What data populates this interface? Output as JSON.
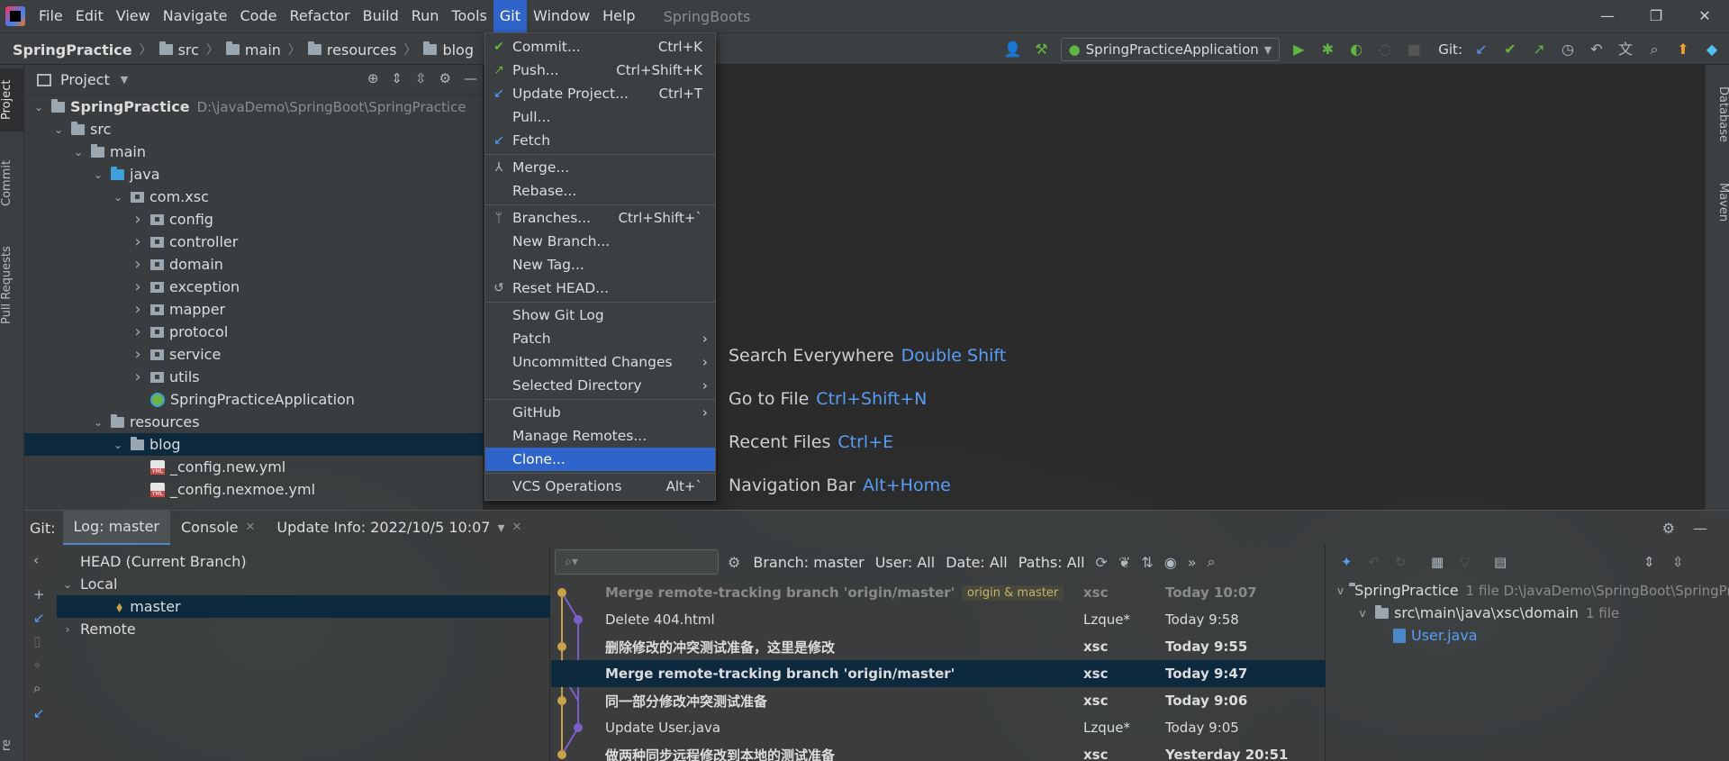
{
  "menubar": {
    "items": [
      "File",
      "Edit",
      "View",
      "Navigate",
      "Code",
      "Refactor",
      "Build",
      "Run",
      "Tools",
      "Git",
      "Window",
      "Help"
    ],
    "active": "Git",
    "window_title": "SpringBoots"
  },
  "window_controls": {
    "minimize": "—",
    "restore": "❐",
    "close": "✕"
  },
  "breadcrumb": [
    "SpringPractice",
    "src",
    "main",
    "resources",
    "blog"
  ],
  "toolbar": {
    "run_config": "SpringPracticeApplication",
    "git_label": "Git:"
  },
  "left_strip": {
    "tabs": [
      "Project",
      "Commit",
      "Pull Requests"
    ],
    "bottom": "re"
  },
  "right_strip": {
    "tabs": [
      "Database",
      "Maven"
    ]
  },
  "project": {
    "header": "Project",
    "tree": [
      {
        "label": "SpringPractice",
        "hint": "D:\\javaDemo\\SpringBoot\\SpringPractice",
        "depth": 0,
        "chev": "v",
        "icon": "module",
        "bold": true
      },
      {
        "label": "src",
        "depth": 1,
        "chev": "v",
        "icon": "folder"
      },
      {
        "label": "main",
        "depth": 2,
        "chev": "v",
        "icon": "folder"
      },
      {
        "label": "java",
        "depth": 3,
        "chev": "v",
        "icon": "folder-blue"
      },
      {
        "label": "com.xsc",
        "depth": 4,
        "chev": "v",
        "icon": "package"
      },
      {
        "label": "config",
        "depth": 5,
        "chev": ">",
        "icon": "package"
      },
      {
        "label": "controller",
        "depth": 5,
        "chev": ">",
        "icon": "package"
      },
      {
        "label": "domain",
        "depth": 5,
        "chev": ">",
        "icon": "package"
      },
      {
        "label": "exception",
        "depth": 5,
        "chev": ">",
        "icon": "package"
      },
      {
        "label": "mapper",
        "depth": 5,
        "chev": ">",
        "icon": "package"
      },
      {
        "label": "protocol",
        "depth": 5,
        "chev": ">",
        "icon": "package"
      },
      {
        "label": "service",
        "depth": 5,
        "chev": ">",
        "icon": "package"
      },
      {
        "label": "utils",
        "depth": 5,
        "chev": ">",
        "icon": "package"
      },
      {
        "label": "SpringPracticeApplication",
        "depth": 5,
        "chev": "",
        "icon": "spring"
      },
      {
        "label": "resources",
        "depth": 3,
        "chev": "v",
        "icon": "folder-res"
      },
      {
        "label": "blog",
        "depth": 4,
        "chev": "v",
        "icon": "folder",
        "selected": true
      },
      {
        "label": "_config.new.yml",
        "depth": 5,
        "chev": "",
        "icon": "yml"
      },
      {
        "label": "_config.nexmoe.yml",
        "depth": 5,
        "chev": "",
        "icon": "yml"
      }
    ]
  },
  "git_menu": {
    "items": [
      {
        "type": "item",
        "icon": "✔",
        "icon_color": "#62b543",
        "label": "Commit...",
        "shortcut": "Ctrl+K"
      },
      {
        "type": "item",
        "icon": "↗",
        "icon_color": "#62b543",
        "label": "Push...",
        "shortcut": "Ctrl+Shift+K"
      },
      {
        "type": "item",
        "icon": "↙",
        "icon_color": "#589df6",
        "label": "Update Project...",
        "shortcut": "Ctrl+T"
      },
      {
        "type": "item",
        "icon": "",
        "label": "Pull...",
        "shortcut": ""
      },
      {
        "type": "item",
        "icon": "↙",
        "icon_color": "#589df6",
        "label": "Fetch",
        "shortcut": ""
      },
      {
        "type": "sep"
      },
      {
        "type": "item",
        "icon": "⅄",
        "icon_color": "#aeb9c0",
        "label": "Merge...",
        "shortcut": ""
      },
      {
        "type": "item",
        "icon": "",
        "label": "Rebase...",
        "shortcut": ""
      },
      {
        "type": "sep"
      },
      {
        "type": "item",
        "icon": "ᛘ",
        "icon_color": "#aeb9c0",
        "label": "Branches...",
        "shortcut": "Ctrl+Shift+`"
      },
      {
        "type": "item",
        "icon": "",
        "label": "New Branch...",
        "shortcut": ""
      },
      {
        "type": "item",
        "icon": "",
        "label": "New Tag...",
        "shortcut": ""
      },
      {
        "type": "item",
        "icon": "↺",
        "icon_color": "#aeb9c0",
        "label": "Reset HEAD...",
        "shortcut": ""
      },
      {
        "type": "sep"
      },
      {
        "type": "item",
        "icon": "",
        "label": "Show Git Log",
        "shortcut": ""
      },
      {
        "type": "item",
        "icon": "",
        "label": "Patch",
        "shortcut": "",
        "submenu": true
      },
      {
        "type": "item",
        "icon": "",
        "label": "Uncommitted Changes",
        "shortcut": "",
        "submenu": true
      },
      {
        "type": "item",
        "icon": "",
        "label": "Selected Directory",
        "shortcut": "",
        "submenu": true
      },
      {
        "type": "sep"
      },
      {
        "type": "item",
        "icon": "",
        "label": "GitHub",
        "shortcut": "",
        "submenu": true
      },
      {
        "type": "item",
        "icon": "",
        "label": "Manage Remotes...",
        "shortcut": ""
      },
      {
        "type": "item",
        "icon": "",
        "label": "Clone...",
        "shortcut": "",
        "selected": true
      },
      {
        "type": "sep"
      },
      {
        "type": "item",
        "icon": "",
        "label": "VCS Operations",
        "shortcut": "Alt+`"
      }
    ]
  },
  "editor_hints": [
    {
      "label": "Search Everywhere",
      "key": "Double Shift"
    },
    {
      "label": "Go to File",
      "key": "Ctrl+Shift+N"
    },
    {
      "label": "Recent Files",
      "key": "Ctrl+E"
    },
    {
      "label": "Navigation Bar",
      "key": "Alt+Home"
    }
  ],
  "git_panel": {
    "label": "Git:",
    "tabs": [
      {
        "label": "Log: master",
        "active": true,
        "closable": false
      },
      {
        "label": "Console",
        "active": false,
        "closable": true
      },
      {
        "label": "Update Info: 2022/10/5 10:07",
        "active": false,
        "closable": true,
        "dropdown": true
      }
    ],
    "branches": [
      {
        "label": "HEAD (Current Branch)",
        "depth": 0,
        "chev": ""
      },
      {
        "label": "Local",
        "depth": 0,
        "chev": "v"
      },
      {
        "label": "master",
        "depth": 1,
        "chev": "",
        "selected": true,
        "tag": true
      },
      {
        "label": "Remote",
        "depth": 0,
        "chev": ">"
      }
    ],
    "filters": {
      "branch": "Branch: master",
      "user": "User: All",
      "date": "Date: All",
      "paths": "Paths: All"
    },
    "commits": [
      {
        "message": "Merge remote-tracking branch 'origin/master'",
        "refs": "origin & master",
        "author": "xsc",
        "date": "Today 10:07",
        "bold": true,
        "faded": true
      },
      {
        "message": "Delete 404.html",
        "author": "Lzque*",
        "date": "Today 9:58"
      },
      {
        "message": "删除修改的冲突测试准备，这里是修改",
        "author": "xsc",
        "date": "Today 9:55",
        "bold": true
      },
      {
        "message": "Merge remote-tracking branch 'origin/master'",
        "author": "xsc",
        "date": "Today 9:47",
        "bold": true,
        "selected": true
      },
      {
        "message": "同一部分修改冲突测试准备",
        "author": "xsc",
        "date": "Today 9:06",
        "bold": true
      },
      {
        "message": "Update User.java",
        "author": "Lzque*",
        "date": "Today 9:05"
      },
      {
        "message": "做两种同步远程修改到本地的测试准备",
        "author": "xsc",
        "date": "Yesterday 20:51",
        "bold": true
      }
    ],
    "changes": {
      "root": {
        "label": "SpringPractice",
        "hint": "1 file  D:\\javaDemo\\SpringBoot\\SpringPr"
      },
      "dir": {
        "label": "src\\main\\java\\xsc\\domain",
        "hint": "1 file"
      },
      "file": "User.java"
    }
  },
  "colors": {
    "accent": "#2f65ca",
    "selection": "#0d293e",
    "link_blue": "#589df6",
    "graph_yellow": "#c8a24a",
    "graph_purple": "#7b5fc9"
  }
}
